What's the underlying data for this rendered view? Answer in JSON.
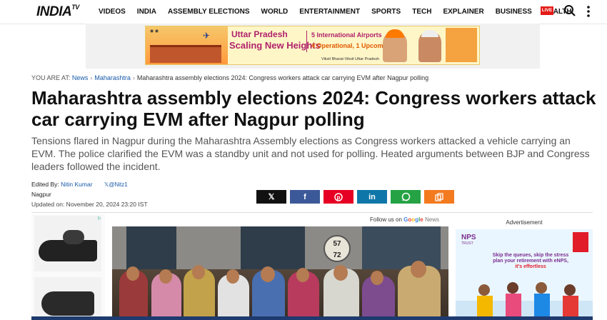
{
  "header": {
    "logo_main": "INDIA",
    "logo_tv": "TV",
    "nav": [
      "VIDEOS",
      "INDIA",
      "ASSEMBLY ELECTIONS",
      "WORLD",
      "ENTERTAINMENT",
      "SPORTS",
      "TECH",
      "EXPLAINER",
      "BUSINESS",
      "HEALTH"
    ],
    "live_label": "LIVE",
    "icons": [
      "search-icon",
      "more-vertical-icon"
    ]
  },
  "banner_ad": {
    "line1": "Uttar Pradesh",
    "line2": "Scaling New Heights",
    "line3": "5 International Airports",
    "line4": "4 Operational, 1 Upcoming",
    "footer": "Viksit Bharat-Viksit Uttar Pradesh"
  },
  "breadcrumb": {
    "label": "YOU ARE AT:",
    "items": [
      "News",
      "Maharashtra",
      "Maharashtra assembly elections 2024: Congress workers attack car carrying EVM after Nagpur polling"
    ]
  },
  "article": {
    "title": "Maharashtra assembly elections 2024: Congress workers attack car carrying EVM after Nagpur polling",
    "summary": "Tensions flared in Nagpur during the Maharashtra Assembly elections as Congress workers attacked a vehicle carrying an EVM. The police clarified the EVM was a standby unit and not used for polling. Heated arguments between BJP and Congress leaders followed the incident.",
    "edited_by_label": "Edited By:",
    "editor": "Nitin Kumar",
    "editor_handle": "@Nitz1",
    "location": "Nagpur",
    "updated": "Updated on: November 20, 2024 23:20 IST"
  },
  "share": {
    "buttons": [
      "x",
      "facebook",
      "pinterest",
      "linkedin",
      "whatsapp",
      "copy"
    ]
  },
  "follow": {
    "label": "Follow us on",
    "google": [
      "G",
      "o",
      "o",
      "g",
      "l",
      "e"
    ],
    "news": "News"
  },
  "photo": {
    "sign_text": "57\n72"
  },
  "right_ad": {
    "label": "Advertisement",
    "brand": "NPS",
    "brand_sub": "TRUST",
    "line1a": "Skip the queues, skip the stress",
    "line2": "plan your retirement with eNPS,",
    "line3": "it's effortless"
  },
  "colors": {
    "accent_red": "#e41b17",
    "link_blue": "#1759a8"
  }
}
